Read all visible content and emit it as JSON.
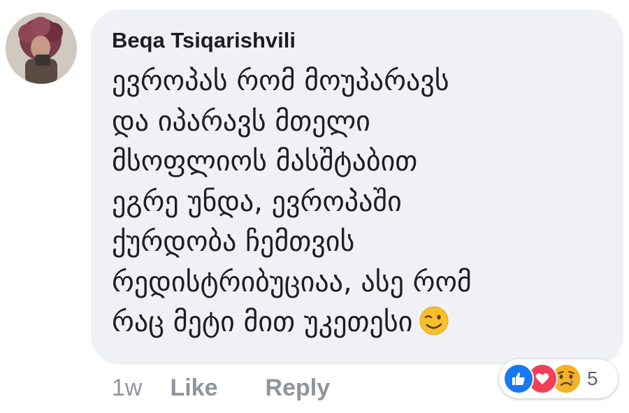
{
  "comment": {
    "author": "Beqa Tsiqarishvili",
    "lines": [
      "ევროპას რომ მოუპარავს",
      "და იპარავს მთელი",
      "მსოფლიოს მასშტაბით",
      "ეგრე უნდა, ევროპაში",
      "ქურდობა ჩემთვის",
      "რედისტრიბუციაა, ასე რომ",
      "რაც მეტი მით უკეთესი"
    ],
    "trailing_emoji": "winking-face-emoji",
    "bubble_color": "#f0f1f4"
  },
  "actions": {
    "timestamp": "1w",
    "like_label": "Like",
    "reply_label": "Reply",
    "text_color": "#90949c"
  },
  "reactions": {
    "icons": [
      "like-icon",
      "love-icon",
      "sad-icon"
    ],
    "count": "5",
    "like_color": "#1877f2",
    "love_color": "#f33e58",
    "sad_color": "#f7b125"
  }
}
